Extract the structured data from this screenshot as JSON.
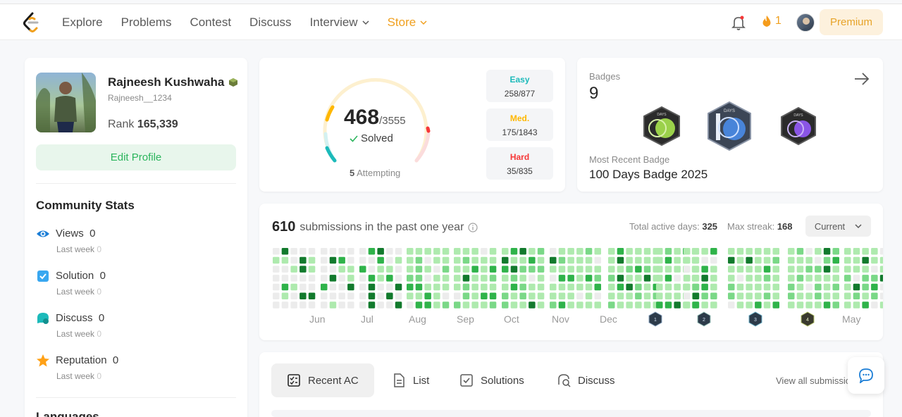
{
  "nav": {
    "items": [
      {
        "label": "Explore"
      },
      {
        "label": "Problems"
      },
      {
        "label": "Contest"
      },
      {
        "label": "Discuss"
      },
      {
        "label": "Interview"
      },
      {
        "label": "Store"
      }
    ],
    "streak": "1",
    "premium": "Premium"
  },
  "profile": {
    "name": "Rajneesh Kushwaha",
    "username": "Rajneesh__1234",
    "rank_label": "Rank",
    "rank_value": "165,339",
    "edit": "Edit Profile"
  },
  "community": {
    "title": "Community Stats",
    "stats": [
      {
        "label": "Views",
        "value": "0",
        "sub": "Last week",
        "sub_value": "0",
        "icon": "eye-icon"
      },
      {
        "label": "Solution",
        "value": "0",
        "sub": "Last week",
        "sub_value": "0",
        "icon": "checkbox-icon"
      },
      {
        "label": "Discuss",
        "value": "0",
        "sub": "Last week",
        "sub_value": "0",
        "icon": "chat-bubble-icon"
      },
      {
        "label": "Reputation",
        "value": "0",
        "sub": "Last week",
        "sub_value": "0",
        "icon": "star-icon"
      }
    ],
    "languages_title": "Languages"
  },
  "solved": {
    "count": "468",
    "total": "/3555",
    "label": "Solved",
    "attempting_count": "5",
    "attempting_label": "Attempting",
    "difficulties": [
      {
        "name": "Easy",
        "value": "258/877",
        "color": "#1cbaba"
      },
      {
        "name": "Med.",
        "value": "175/1843",
        "color": "#ffb700"
      },
      {
        "name": "Hard",
        "value": "35/835",
        "color": "#f63737"
      }
    ]
  },
  "badges": {
    "title": "Badges",
    "count": "9",
    "recent_title": "Most Recent Badge",
    "recent_name": "100 Days Badge 2025"
  },
  "submissions": {
    "count": "610",
    "text": "submissions in the past one year",
    "active_label": "Total active days:",
    "active_value": "325",
    "streak_label": "Max streak:",
    "streak_value": "168",
    "range": "Current",
    "months": [
      "Jun",
      "Jul",
      "Aug",
      "Sep",
      "Oct",
      "Nov",
      "Dec",
      "May"
    ],
    "hex_badges": [
      "1",
      "2",
      "3",
      "4"
    ]
  },
  "tabs": {
    "items": [
      {
        "label": "Recent AC"
      },
      {
        "label": "List"
      },
      {
        "label": "Solutions"
      },
      {
        "label": "Discuss"
      }
    ],
    "view_all": "View all submissions"
  }
}
